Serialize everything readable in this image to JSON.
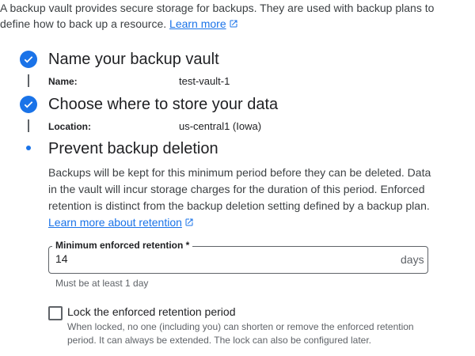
{
  "intro": {
    "text": "A backup vault provides secure storage for backups. They are used with backup plans to define how to back up a resource.",
    "link": "Learn more"
  },
  "steps": [
    {
      "title": "Name your backup vault",
      "label": "Name:",
      "value": "test-vault-1",
      "status": "complete"
    },
    {
      "title": "Choose where to store your data",
      "label": "Location:",
      "value": "us-central1 (Iowa)",
      "status": "complete"
    },
    {
      "title": "Prevent backup deletion",
      "status": "current"
    }
  ],
  "retention": {
    "description": "Backups will be kept for this minimum period before they can be deleted. Data in the vault will incur storage charges for the duration of this period. Enforced retention is distinct from the backup deletion setting defined by a backup plan.",
    "link": "Learn more about retention",
    "field_label": "Minimum enforced retention *",
    "field_value": "14",
    "field_suffix": "days",
    "hint": "Must be at least 1 day",
    "lock_label": "Lock the enforced retention period",
    "lock_description": "When locked, no one (including you) can shorten or remove the enforced retention period. It can always be extended. The lock can also be configured later.",
    "lock_checked": false
  },
  "colors": {
    "accent": "#1a73e8",
    "text": "#202124",
    "muted": "#5f6368"
  },
  "icons": {
    "step_complete": "check-icon",
    "step_current": "dot-icon",
    "external": "open-in-new-icon"
  }
}
